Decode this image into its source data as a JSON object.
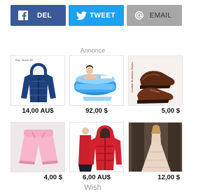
{
  "share": {
    "facebook": {
      "label": "DEL",
      "icon": "facebook-icon",
      "color": "#3b5998"
    },
    "twitter": {
      "label": "TWEET",
      "icon": "twitter-icon",
      "color": "#1da1f2"
    },
    "email": {
      "label": "EMAIL",
      "icon": "at-sign-icon",
      "color": "#a7a7a7"
    }
  },
  "ad": {
    "label": "Annonce",
    "products": [
      {
        "price": "14,00 AU$",
        "image": "blue-puffer-jacket",
        "image_text": "Buy Jacket $6"
      },
      {
        "price": "92,00 $",
        "image": "inflatable-bathtub"
      },
      {
        "price": "5,00 $",
        "image": "brown-leather-shoes",
        "image_text": "Leather Business Shoes"
      },
      {
        "price": "4,00 $",
        "image": "pink-shorts"
      },
      {
        "price": "6,00 AU$",
        "image": "red-puffer-jacket"
      },
      {
        "price": "12,00 $",
        "image": "evening-gown"
      }
    ]
  },
  "footer": {
    "label": "Wish"
  }
}
